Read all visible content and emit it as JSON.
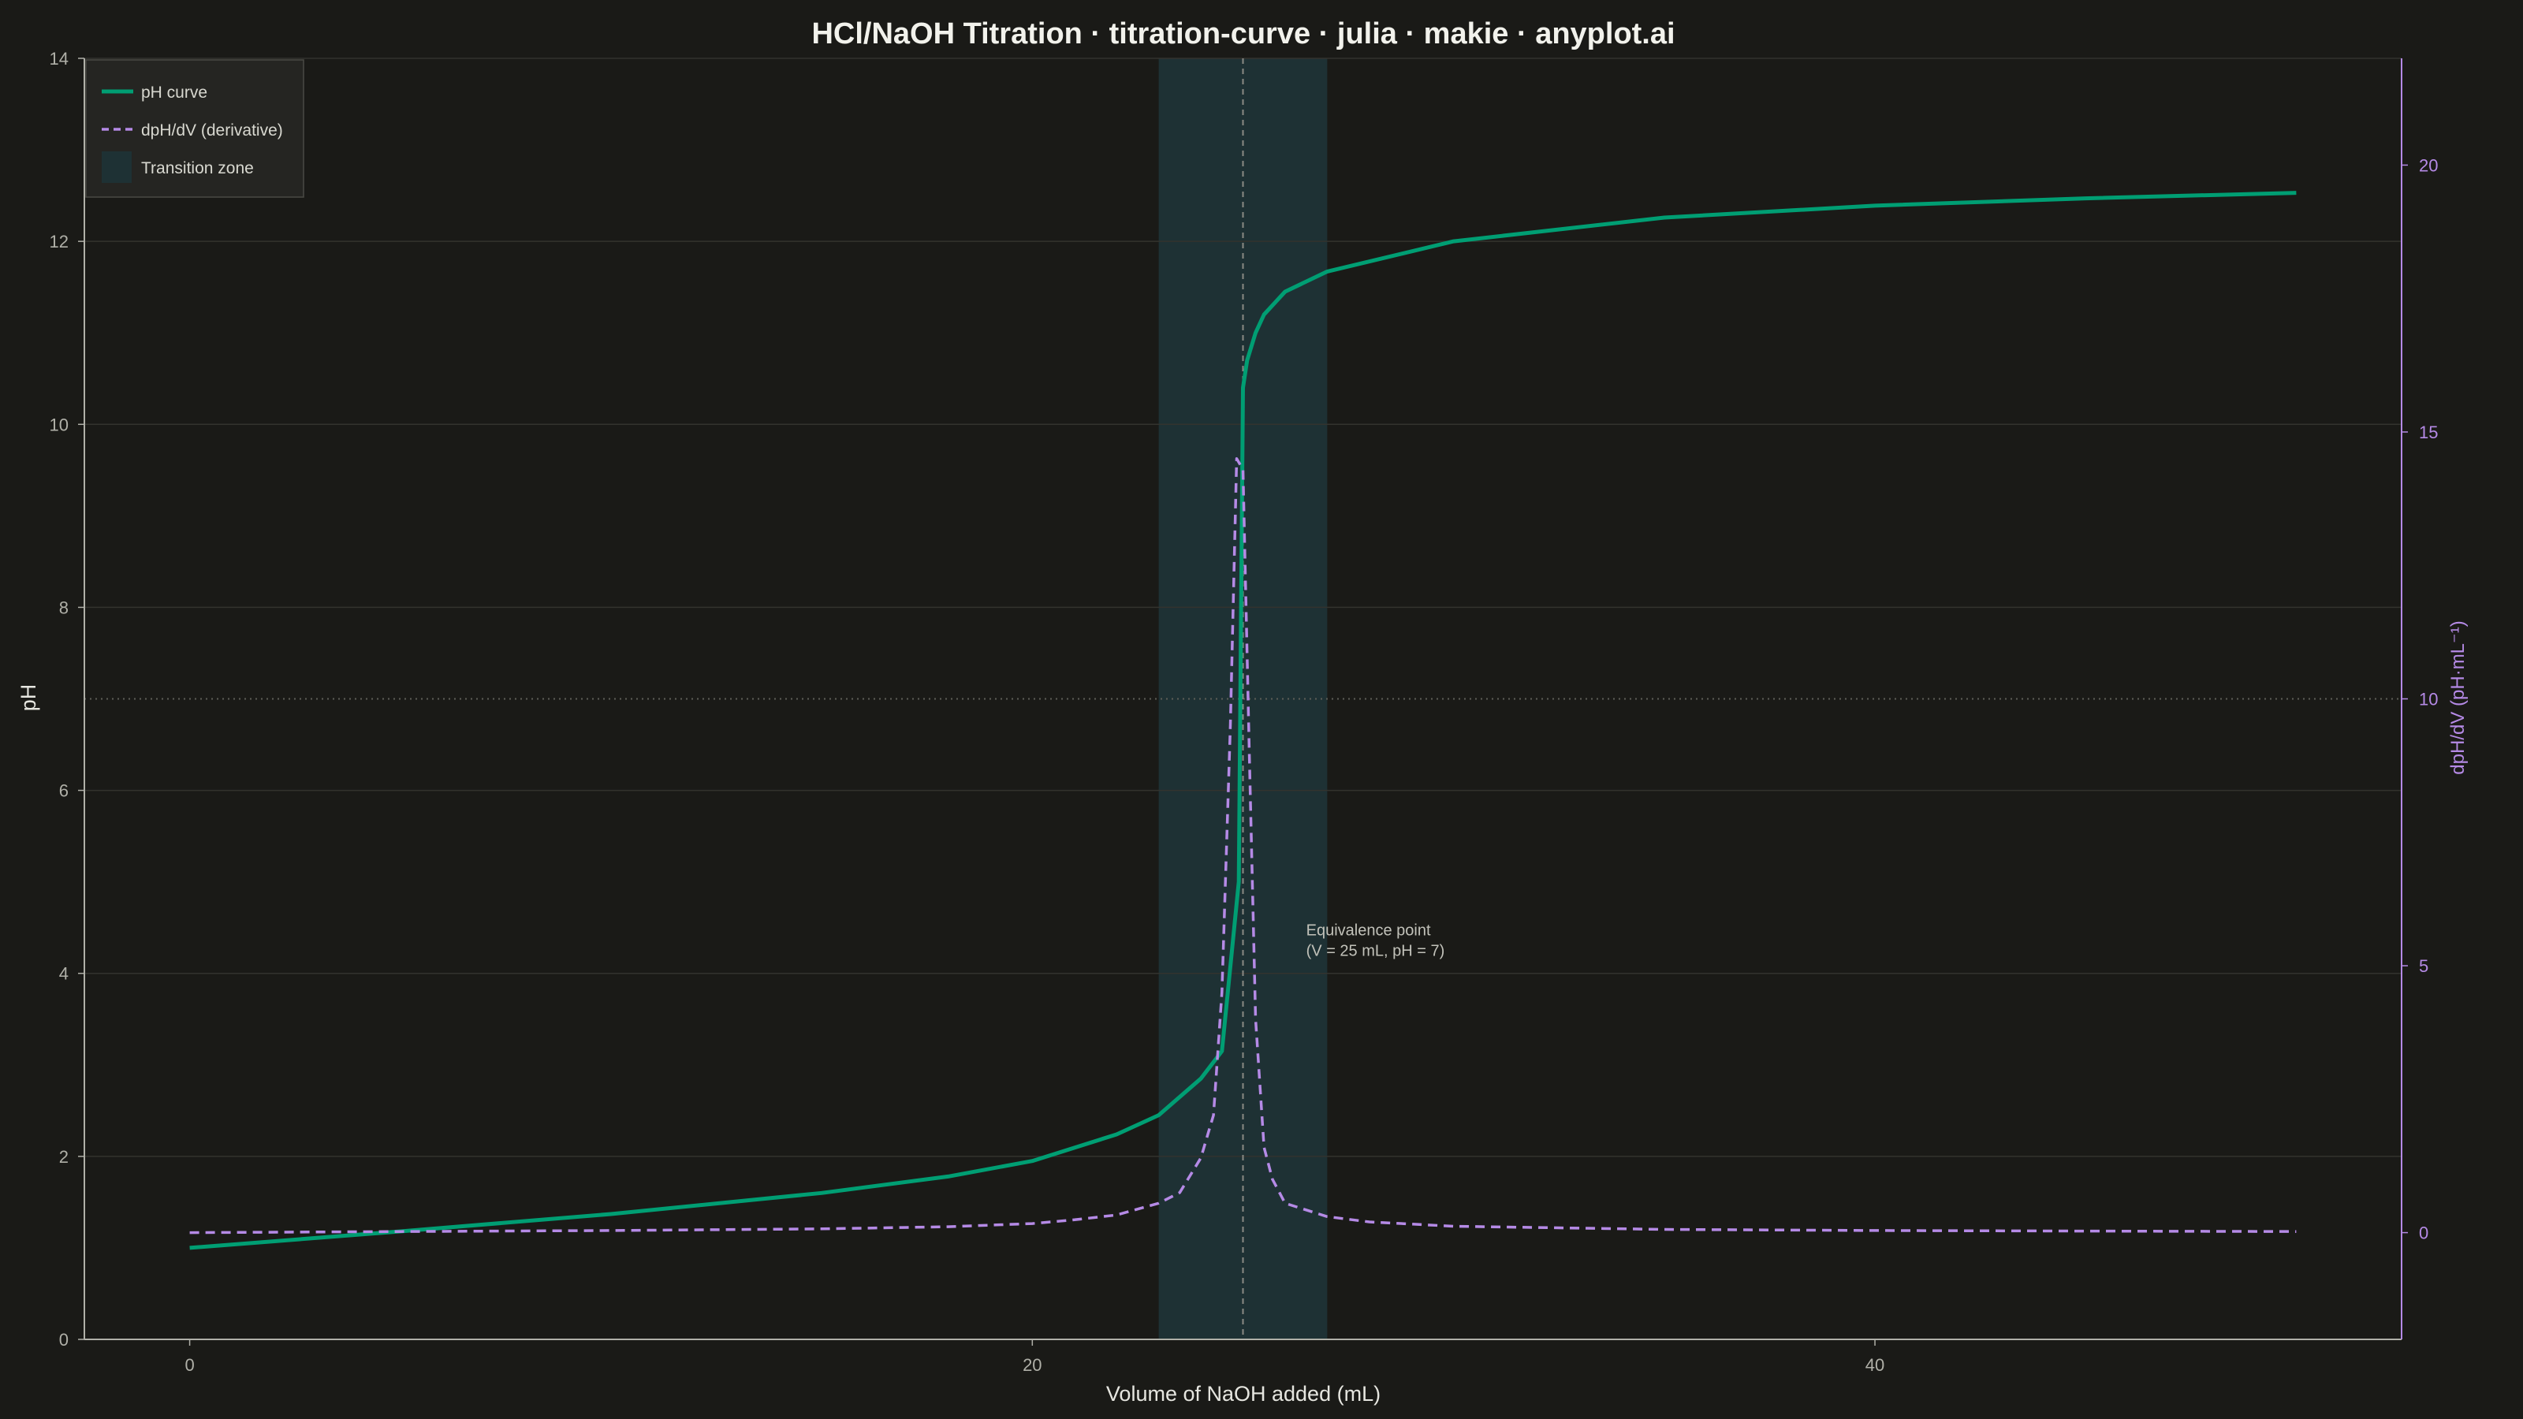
{
  "chart_data": {
    "type": "line",
    "title": "HCl/NaOH Titration · titration-curve · julia · makie · anyplot.ai",
    "xlabel": "Volume of NaOH added (mL)",
    "ylabel": "pH",
    "y2label": "dpH/dV (pH·mL⁻¹)",
    "xlim": [
      -2.5,
      52.5
    ],
    "ylim": [
      0,
      14
    ],
    "y2lim": [
      -2,
      22
    ],
    "xticks": [
      "0",
      "20",
      "40"
    ],
    "xtick_values": [
      0,
      20,
      40
    ],
    "yticks": [
      "0",
      "2",
      "4",
      "6",
      "8",
      "10",
      "12",
      "14"
    ],
    "ytick_values": [
      0,
      2,
      4,
      6,
      8,
      10,
      12,
      14
    ],
    "y2ticks": [
      "0",
      "5",
      "10",
      "15",
      "20"
    ],
    "y2tick_values": [
      0,
      5,
      10,
      15,
      20
    ],
    "grid": true,
    "legend_position": "top-left",
    "legend": [
      {
        "label": "pH curve",
        "kind": "line"
      },
      {
        "label": "dpH/dV (derivative)",
        "kind": "dashed"
      },
      {
        "label": "Transition zone",
        "kind": "patch"
      }
    ],
    "transition_zone": [
      23,
      27
    ],
    "equivalence_volume": 25,
    "neutral_ph": 7,
    "annotation_line1": "Equivalence point",
    "annotation_line2": "(V = 25 mL, pH = 7)",
    "annotation_anchor": [
      26.5,
      4.4
    ],
    "series": [
      {
        "name": "pH curve",
        "axis": "left",
        "color": "#009e73",
        "x": [
          0,
          5,
          10,
          15,
          18,
          20,
          22,
          23,
          24,
          24.5,
          24.9,
          25,
          25.1,
          25.3,
          25.5,
          26,
          27,
          30,
          35,
          40,
          45,
          50
        ],
        "y": [
          1.0,
          1.18,
          1.37,
          1.6,
          1.78,
          1.95,
          2.24,
          2.45,
          2.85,
          3.15,
          5.0,
          10.4,
          10.7,
          11.0,
          11.2,
          11.45,
          11.67,
          12.0,
          12.26,
          12.39,
          12.47,
          12.53
        ]
      },
      {
        "name": "dpH/dV (derivative)",
        "axis": "right",
        "color": "#b58ae6",
        "x": [
          0,
          5,
          10,
          15,
          18,
          20,
          21,
          22,
          23,
          23.5,
          24,
          24.3,
          24.5,
          24.7,
          24.85,
          25,
          25.15,
          25.3,
          25.5,
          25.7,
          26,
          27,
          28,
          30,
          35,
          40,
          45,
          50
        ],
        "y": [
          0.0,
          0.02,
          0.04,
          0.07,
          0.11,
          0.17,
          0.24,
          0.33,
          0.55,
          0.75,
          1.4,
          2.2,
          4.5,
          9.5,
          14.5,
          14.3,
          9.0,
          4.0,
          1.6,
          1.0,
          0.55,
          0.3,
          0.2,
          0.12,
          0.06,
          0.04,
          0.03,
          0.02
        ]
      }
    ],
    "colors": {
      "background": "#1a1a17",
      "ph_curve": "#009e73",
      "derivative": "#b58ae6",
      "transition_zone": "#1e3134",
      "grid": "#33332e",
      "axis": "#b0b0a8",
      "text": "#e6e6e0"
    }
  }
}
